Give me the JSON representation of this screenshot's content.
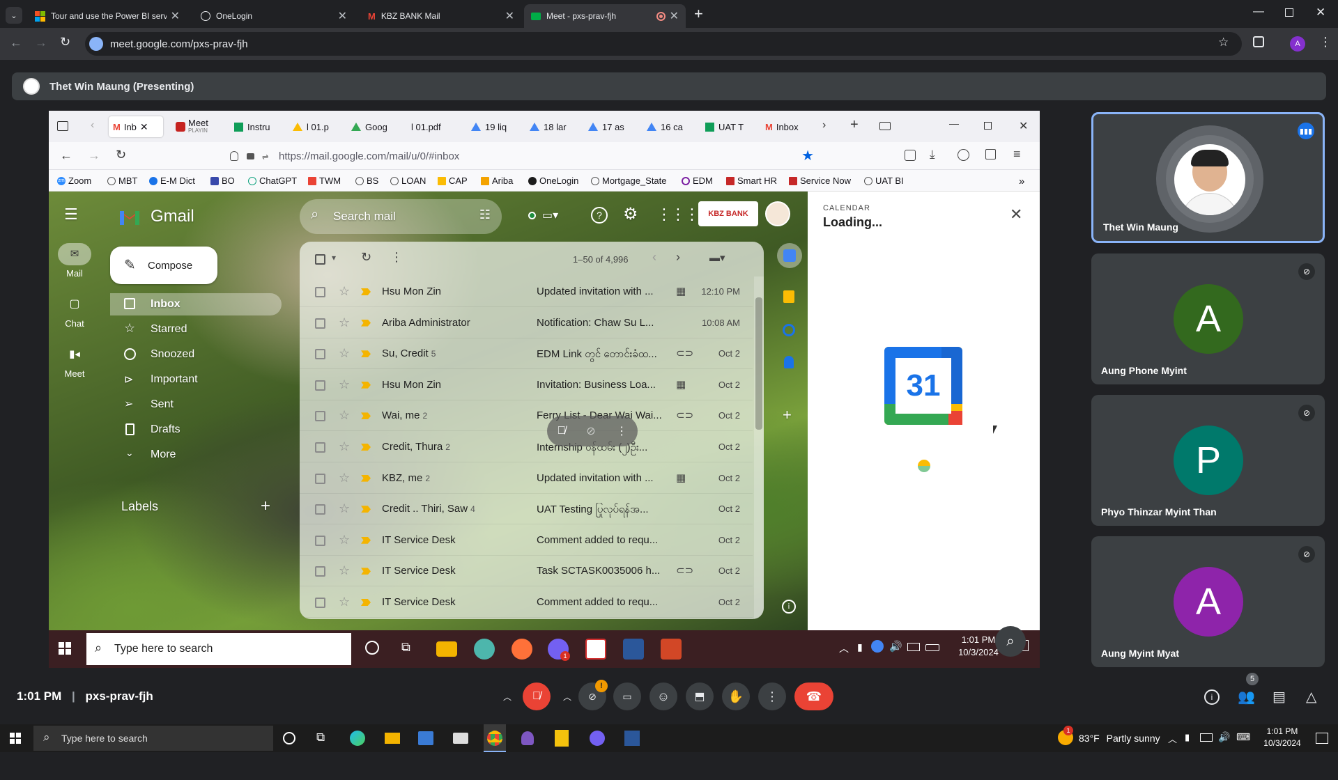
{
  "outer_tabs": [
    {
      "title": "Tour and use the Power BI servi"
    },
    {
      "title": "OneLogin"
    },
    {
      "title": "KBZ BANK Mail"
    },
    {
      "title": "Meet - pxs-prav-fjh"
    }
  ],
  "outer_url": "meet.google.com/pxs-prav-fjh",
  "profile_initial": "A",
  "presenting": "Thet Win Maung (Presenting)",
  "firefox": {
    "tabs": [
      "Inb",
      "Meet",
      "Instru",
      "l 01.p",
      "Goog",
      "l 01.pdf",
      "19 liq",
      "18 lar",
      "17 as",
      "16 ca",
      "UAT T",
      "Inbox"
    ],
    "meet_tab_sub": "PLAYIN",
    "url": "https://mail.google.com/mail/u/0/#inbox",
    "bookmarks": [
      "Zoom",
      "MBT",
      "E-M Dict",
      "BO",
      "ChatGPT",
      "TWM",
      "BS",
      "LOAN",
      "CAP",
      "Ariba",
      "OneLogin",
      "Mortgage_State",
      "EDM",
      "Smart HR",
      "Service Now",
      "UAT BI"
    ],
    "zoom_badge": "zm"
  },
  "gmail": {
    "logo": "Gmail",
    "search_placeholder": "Search mail",
    "compose": "Compose",
    "rail": [
      "Mail",
      "Chat",
      "Meet"
    ],
    "nav": [
      "Inbox",
      "Starred",
      "Snoozed",
      "Important",
      "Sent",
      "Drafts",
      "More"
    ],
    "labels": "Labels",
    "brand": "KBZ BANK",
    "pagination": "1–50 of 4,996",
    "emails": [
      {
        "sender": "Hsu Mon Zin",
        "count": "",
        "subject": "Updated invitation with ...",
        "att": "cal",
        "date": "12:10 PM"
      },
      {
        "sender": "Ariba Administrator",
        "count": "",
        "subject": "Notification: Chaw Su L...",
        "att": "",
        "date": "10:08 AM"
      },
      {
        "sender": "Su, Credit",
        "count": "5",
        "subject": "EDM Link တွင် တောင်းခံထ...",
        "att": "clip",
        "date": "Oct 2"
      },
      {
        "sender": "Hsu Mon Zin",
        "count": "",
        "subject": "Invitation: Business Loa...",
        "att": "cal",
        "date": "Oct 2"
      },
      {
        "sender": "Wai, me",
        "count": "2",
        "subject": "Ferry List - Dear Wai Wai...",
        "att": "clip",
        "date": "Oct 2"
      },
      {
        "sender": "Credit, Thura",
        "count": "2",
        "subject": "Internship ဝန်ထမ်း (၂)ဦး...",
        "att": "",
        "date": "Oct 2"
      },
      {
        "sender": "KBZ, me",
        "count": "2",
        "subject": "Updated invitation with ...",
        "att": "cal",
        "date": "Oct 2"
      },
      {
        "sender": "Credit .. Thiri, Saw",
        "count": "4",
        "subject": "UAT Testing ပြုလုပ်ရန်အ...",
        "att": "",
        "date": "Oct 2"
      },
      {
        "sender": "IT Service Desk",
        "count": "",
        "subject": "Comment added to requ...",
        "att": "",
        "date": "Oct 2"
      },
      {
        "sender": "IT Service Desk",
        "count": "",
        "subject": "Task SCTASK0035006 h...",
        "att": "clip",
        "date": "Oct 2"
      },
      {
        "sender": "IT Service Desk",
        "count": "",
        "subject": "Comment added to requ...",
        "att": "",
        "date": "Oct 2"
      }
    ]
  },
  "calendar": {
    "label": "CALENDAR",
    "status": "Loading...",
    "logo_text": "31"
  },
  "inner_taskbar": {
    "search": "Type here to search",
    "time": "1:01 PM",
    "date": "10/3/2024",
    "badge": "1"
  },
  "participants": [
    {
      "name": "Thet Win Maung",
      "initial": "",
      "color": "#ffffff"
    },
    {
      "name": "Aung Phone Myint",
      "initial": "A",
      "color": "#33691e"
    },
    {
      "name": "Phyo Thinzar Myint Than",
      "initial": "P",
      "color": "#00796b"
    },
    {
      "name": "Aung Myint Myat",
      "initial": "A",
      "color": "#8e24aa"
    }
  ],
  "meet_bar": {
    "time": "1:01 PM",
    "code": "pxs-prav-fjh",
    "people_count": "5",
    "cam_badge": "!"
  },
  "os_taskbar": {
    "search": "Type here to search",
    "weather": "83°F",
    "weather_desc": "Partly sunny",
    "time": "1:01 PM",
    "date": "10/3/2024",
    "notif": "1"
  }
}
